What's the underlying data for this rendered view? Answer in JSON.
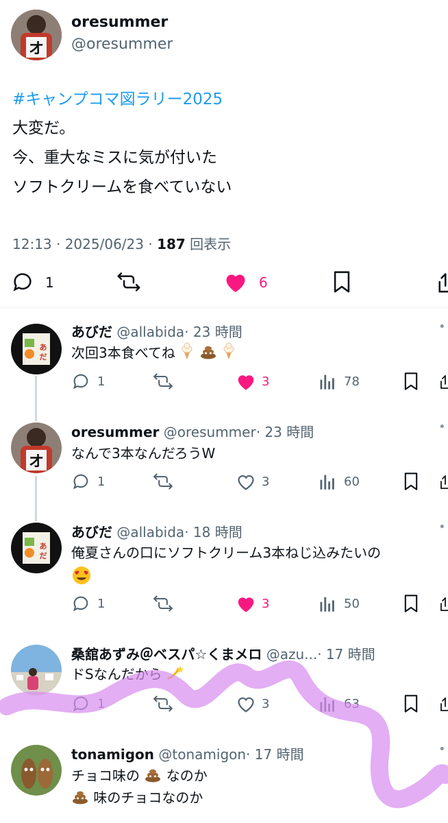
{
  "tweet": {
    "author_name": "oresummer",
    "author_handle": "@oresummer",
    "hashtag": "#キャンプコマ図ラリー2025",
    "lines": [
      "大変だ。",
      "今、重大なミスに気が付いた",
      "ソフトクリームを食べていない"
    ],
    "time": "12:13 · 2025/06/23 · ",
    "views": "187",
    "views_label": " 回表示",
    "reply_count": "1",
    "like_count": "6"
  },
  "replies": [
    {
      "name": "あびだ",
      "handle": "@allabida",
      "time": "· 23 時間",
      "text_line1": "次回3本食べてね",
      "text_line2": "",
      "replies": "1",
      "likes": "3",
      "liked": true,
      "views": "78"
    },
    {
      "name": "oresummer",
      "handle": "@oresummer",
      "time": "· 23 時間",
      "text_line1": "なんで3本なんだろうW",
      "text_line2": "",
      "replies": "1",
      "likes": "3",
      "liked": false,
      "views": "60"
    },
    {
      "name": "あびだ",
      "handle": "@allabida",
      "time": "· 18 時間",
      "text_line1": "俺夏さんの口にソフトクリーム3本ねじ込みたいの",
      "text_line2": "",
      "replies": "1",
      "likes": "3",
      "liked": true,
      "views": "50"
    },
    {
      "name": "桑舘あずみ＠ベスパ☆くまメロ",
      "handle": "@azu...",
      "time": "· 17 時間",
      "text_line1": "ドSなんだから",
      "text_line2": "",
      "replies": "1",
      "likes": "3",
      "liked": false,
      "views": "63"
    },
    {
      "name": "tonamigon",
      "handle": "@tonamigon",
      "time": "· 17 時間",
      "text_line1a": "チョコ味の",
      "text_line1b": "なのか",
      "text_line2": "味のチョコなのか"
    }
  ],
  "colors": {
    "pink": "#f91880",
    "hashtag": "#1d9bf0",
    "muted": "#536471",
    "highlight_stroke": "#d78cf0"
  }
}
